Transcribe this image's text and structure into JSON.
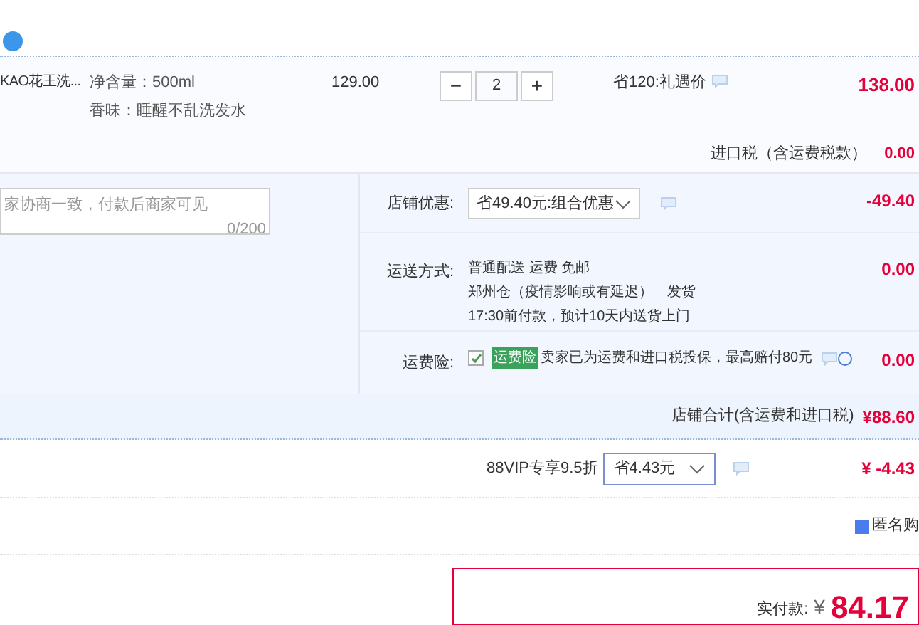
{
  "product": {
    "name": "KAO花王洗...",
    "specs": [
      "净含量：500ml",
      "香味：睡醒不乱洗发水"
    ],
    "unit_price": "129.00",
    "quantity": {
      "minus": "−",
      "value": "2",
      "plus": "+"
    },
    "promo": "省120:礼遇价",
    "subtotal": "138.00"
  },
  "import_tax": {
    "label": "进口税（含运费税款）",
    "value": "0.00"
  },
  "message": {
    "placeholder": "家协商一致，付款后商家可见",
    "counter": "0/200"
  },
  "options": [
    {
      "kind": "select",
      "label": "店铺优惠:",
      "select": "省49.40元:组合优惠",
      "amount": "-49.40"
    },
    {
      "kind": "lines",
      "label": "运送方式:",
      "lines": [
        "普通配送 运费 免邮",
        "郑州仓（疫情影响或有延迟）　发货",
        "17:30前付款，预计10天内送货上门"
      ],
      "amount": "0.00"
    },
    {
      "kind": "insurance",
      "label": "运费险:",
      "checked": true,
      "tag": "运费险",
      "text": "卖家已为运费和进口税投保，最高赔付80元",
      "amount": "0.00"
    }
  ],
  "shop_total": {
    "label": "店铺合计(含运费和进口税)",
    "value": "¥88.60"
  },
  "vip": {
    "label": "88VIP专享9.5折",
    "select": "省4.43元",
    "amount": "¥ -4.43"
  },
  "anonymous": {
    "label": "匿名购",
    "checked": true
  },
  "payment": {
    "label": "实付款:",
    "currency": "¥",
    "value": "84.17"
  }
}
